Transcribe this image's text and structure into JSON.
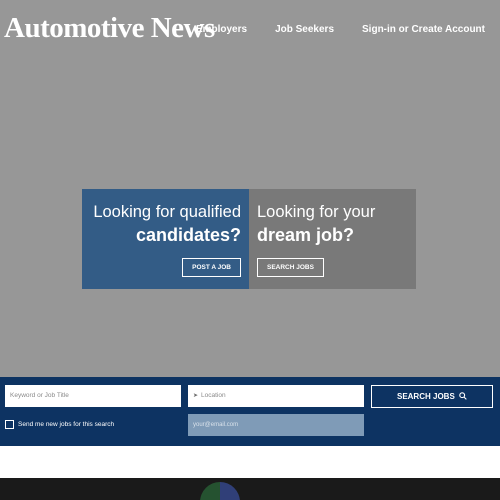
{
  "header": {
    "logo": "Automotive News",
    "nav": [
      "Employers",
      "Job Seekers",
      "Sign-in or Create Account"
    ]
  },
  "hero": {
    "employer": {
      "line1": "Looking for qualified",
      "line2": "candidates?",
      "button": "POST A JOB"
    },
    "seeker": {
      "line1": "Looking for your",
      "line2": "dream job?",
      "button": "SEARCH JOBS"
    }
  },
  "search": {
    "keyword_placeholder": "Keyword or Job Title",
    "location_placeholder": "Location",
    "button": "SEARCH JOBS",
    "checkbox_label": "Send me new jobs for this search",
    "email_placeholder": "your@email.com"
  },
  "colors": {
    "overlay": "#979797",
    "employer_panel": "#335c86",
    "seeker_panel": "#797979",
    "search_bar": "#0d3362"
  },
  "icons": {
    "location": "location-arrow-icon",
    "search": "magnifier-icon"
  }
}
